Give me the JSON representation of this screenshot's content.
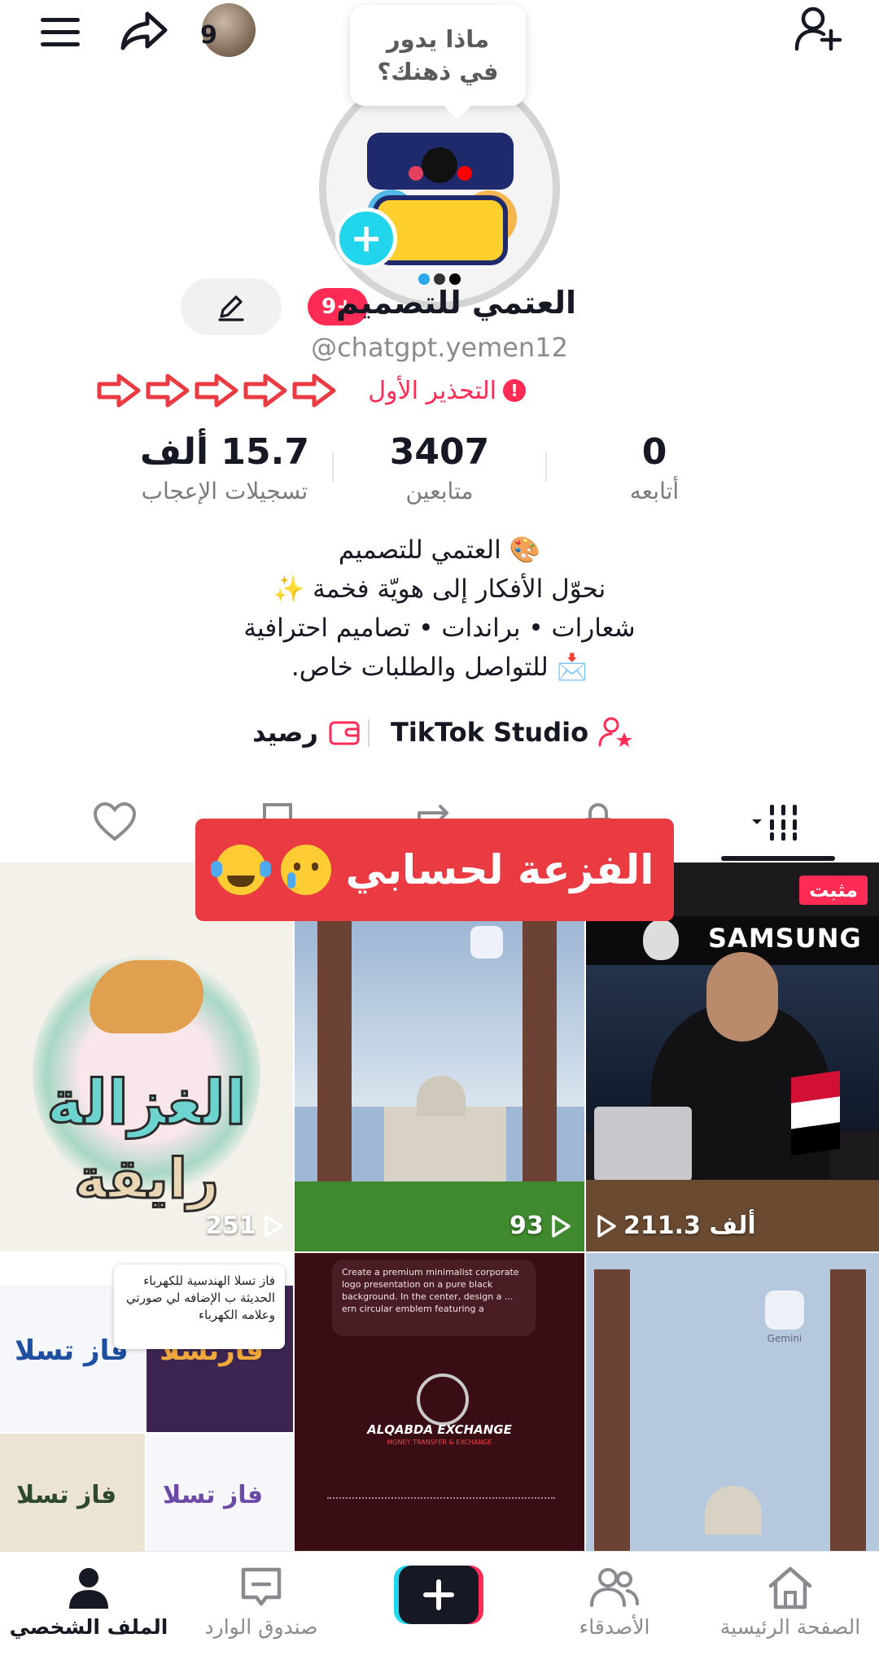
{
  "top_bar": {
    "avatar_count": "9",
    "thought_bubble": "ماذا يدور في ذهنك؟"
  },
  "profile": {
    "name": "العتمي للتصميم",
    "notification_badge": "9+",
    "handle": "@chatgpt.yemen12",
    "warning_text": "التحذير الأول",
    "warning_arrow_count": 5
  },
  "stats": {
    "following": {
      "value": "0",
      "label": "أتابعه"
    },
    "followers": {
      "value": "3407",
      "label": "متابعين"
    },
    "likes": {
      "value": "15.7 ألف",
      "label": "تسجيلات الإعجاب"
    }
  },
  "bio": {
    "lines": [
      "🎨 العتمي للتصميم",
      "نحوّل الأفكار إلى هويّة فخمة ✨",
      "شعارات • براندات • تصاميم احترافية",
      "📩 للتواصل والطلبات خاص."
    ]
  },
  "links": {
    "studio": "TikTok Studio",
    "balance": "رصيد"
  },
  "overlay": {
    "text": "الفزعة لحسابي"
  },
  "videos": [
    {
      "views": "211.3 ألف",
      "badge": "مثبت",
      "brand": "SAMSUNG"
    },
    {
      "views": "93"
    },
    {
      "views": "251",
      "title_line1": "الغزالة",
      "title_line2": "رايقة"
    },
    {
      "caption": "Gemini"
    },
    {
      "prompt": "Create a premium minimalist corporate logo presentation on a pure black background. In the center, design a ... ern circular emblem featuring a",
      "logo_title": "ALQABDA EXCHANGE",
      "logo_sub": "MONEY TRANSFER & EXCHANGE"
    },
    {
      "comment": "فاز تسلا الهندسية للكهرباء الحديثة ب الإضافه لي صورتي وعلامه الكهرباء",
      "logo_a": "فاز تسلا",
      "logo_b": "فارنسلا"
    }
  ],
  "bottom_nav": {
    "home": "الصفحة الرئيسية",
    "friends": "الأصدقاء",
    "inbox": "صندوق الوارد",
    "profile": "الملف الشخصي"
  },
  "colors": {
    "accent": "#fe2c55",
    "cyan": "#20d5ec",
    "overlay_red": "#ea3b42"
  }
}
